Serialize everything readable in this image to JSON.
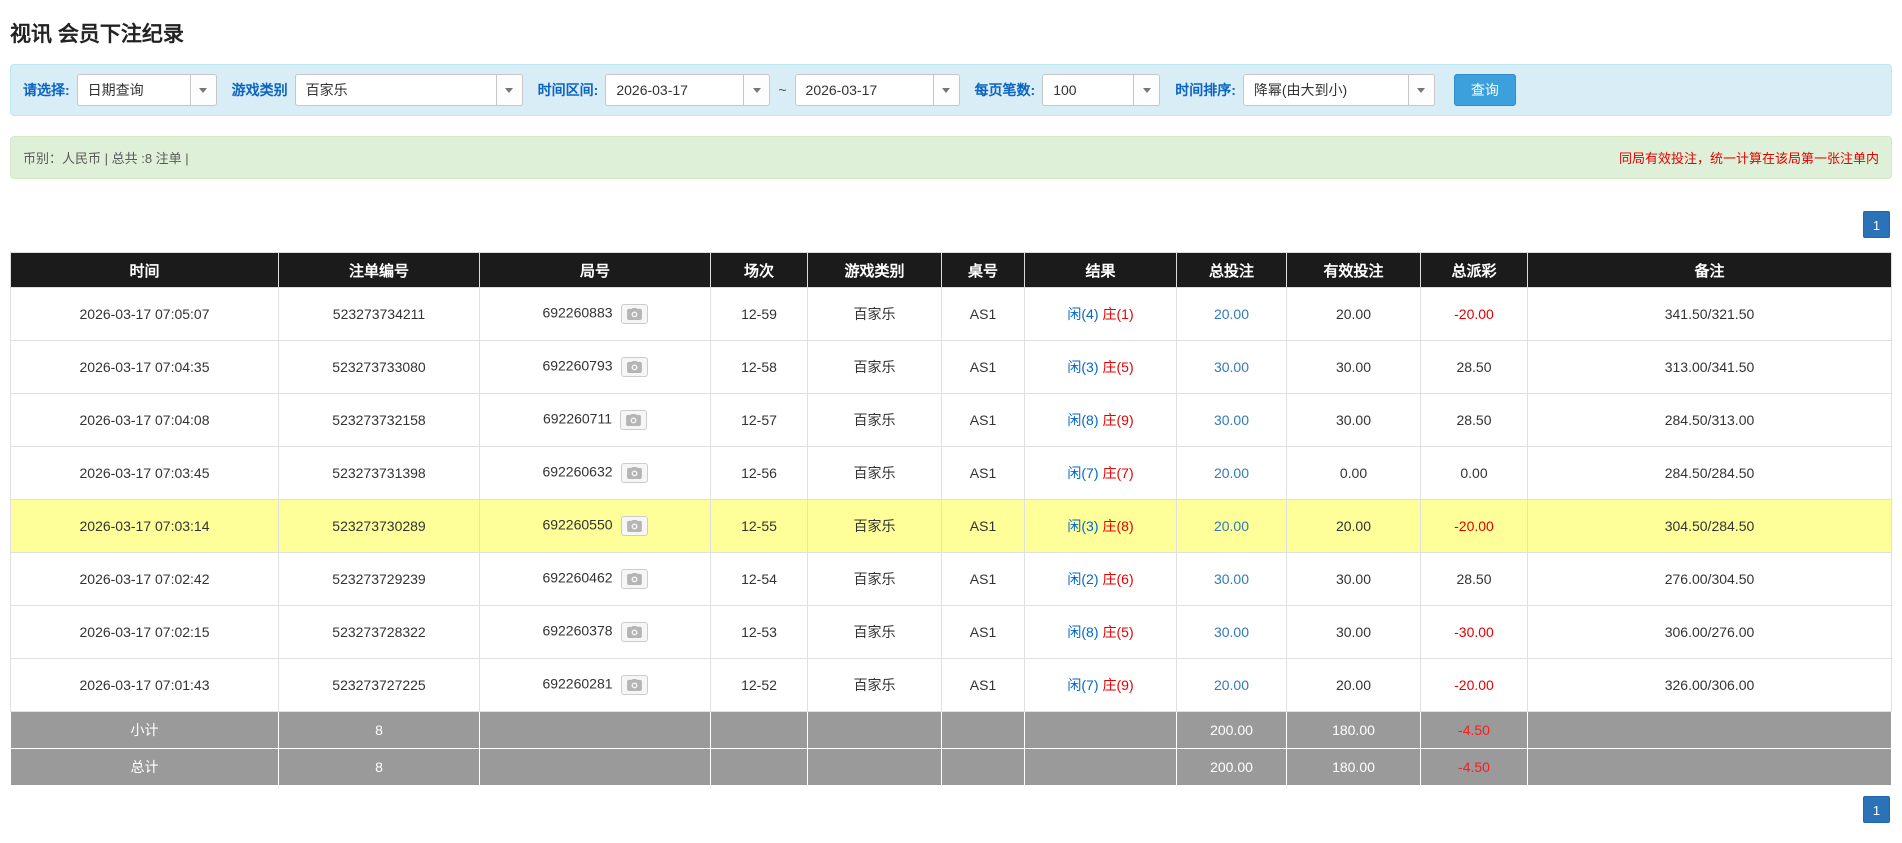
{
  "page": {
    "title": "视讯 会员下注纪录"
  },
  "filter": {
    "select_label": "请选择:",
    "query_type": "日期查询",
    "game_type_label": "游戏类别",
    "game_type": "百家乐",
    "time_range_label": "时间区间:",
    "date_from": "2026-03-17",
    "range_separator": "~",
    "date_to": "2026-03-17",
    "page_size_label": "每页笔数:",
    "page_size": "100",
    "sort_label": "时间排序:",
    "sort_value": "降幂(由大到小)",
    "search_button": "查询"
  },
  "info_bar": {
    "summary": "币别：人民币 | 总共 :8 注单 |",
    "notice": "同局有效投注，统一计算在该局第一张注单内"
  },
  "pagination": {
    "page": "1"
  },
  "colors": {
    "accent_blue": "#0a64c2",
    "link_blue": "#337ab7",
    "negative_red": "#e60000",
    "player_blue": "#0066cc",
    "banker_red": "#e60000",
    "highlight_yellow": "#ffff99",
    "header_bg": "#1b1b1b",
    "summary_bg": "#9a9a9a"
  },
  "table": {
    "headers": [
      "时间",
      "注单编号",
      "局号",
      "场次",
      "游戏类别",
      "桌号",
      "结果",
      "总投注",
      "有效投注",
      "总派彩",
      "备注"
    ],
    "rows": [
      {
        "time": "2026-03-17 07:05:07",
        "bet_id": "523273734211",
        "round_no": "692260883",
        "session": "12-59",
        "game_type": "百家乐",
        "table_no": "AS1",
        "result_player": "闲(4)",
        "result_banker": "庄(1)",
        "total_bet": "20.00",
        "valid_bet": "20.00",
        "payout": "-20.00",
        "remark": "341.50/321.50",
        "highlight": false
      },
      {
        "time": "2026-03-17 07:04:35",
        "bet_id": "523273733080",
        "round_no": "692260793",
        "session": "12-58",
        "game_type": "百家乐",
        "table_no": "AS1",
        "result_player": "闲(3)",
        "result_banker": "庄(5)",
        "total_bet": "30.00",
        "valid_bet": "30.00",
        "payout": "28.50",
        "remark": "313.00/341.50",
        "highlight": false
      },
      {
        "time": "2026-03-17 07:04:08",
        "bet_id": "523273732158",
        "round_no": "692260711",
        "session": "12-57",
        "game_type": "百家乐",
        "table_no": "AS1",
        "result_player": "闲(8)",
        "result_banker": "庄(9)",
        "total_bet": "30.00",
        "valid_bet": "30.00",
        "payout": "28.50",
        "remark": "284.50/313.00",
        "highlight": false
      },
      {
        "time": "2026-03-17 07:03:45",
        "bet_id": "523273731398",
        "round_no": "692260632",
        "session": "12-56",
        "game_type": "百家乐",
        "table_no": "AS1",
        "result_player": "闲(7)",
        "result_banker": "庄(7)",
        "total_bet": "20.00",
        "valid_bet": "0.00",
        "payout": "0.00",
        "remark": "284.50/284.50",
        "highlight": false
      },
      {
        "time": "2026-03-17 07:03:14",
        "bet_id": "523273730289",
        "round_no": "692260550",
        "session": "12-55",
        "game_type": "百家乐",
        "table_no": "AS1",
        "result_player": "闲(3)",
        "result_banker": "庄(8)",
        "total_bet": "20.00",
        "valid_bet": "20.00",
        "payout": "-20.00",
        "remark": "304.50/284.50",
        "highlight": true
      },
      {
        "time": "2026-03-17 07:02:42",
        "bet_id": "523273729239",
        "round_no": "692260462",
        "session": "12-54",
        "game_type": "百家乐",
        "table_no": "AS1",
        "result_player": "闲(2)",
        "result_banker": "庄(6)",
        "total_bet": "30.00",
        "valid_bet": "30.00",
        "payout": "28.50",
        "remark": "276.00/304.50",
        "highlight": false
      },
      {
        "time": "2026-03-17 07:02:15",
        "bet_id": "523273728322",
        "round_no": "692260378",
        "session": "12-53",
        "game_type": "百家乐",
        "table_no": "AS1",
        "result_player": "闲(8)",
        "result_banker": "庄(5)",
        "total_bet": "30.00",
        "valid_bet": "30.00",
        "payout": "-30.00",
        "remark": "306.00/276.00",
        "highlight": false
      },
      {
        "time": "2026-03-17 07:01:43",
        "bet_id": "523273727225",
        "round_no": "692260281",
        "session": "12-52",
        "game_type": "百家乐",
        "table_no": "AS1",
        "result_player": "闲(7)",
        "result_banker": "庄(9)",
        "total_bet": "20.00",
        "valid_bet": "20.00",
        "payout": "-20.00",
        "remark": "326.00/306.00",
        "highlight": false
      }
    ],
    "subtotal": {
      "label": "小计",
      "count": "8",
      "total_bet": "200.00",
      "valid_bet": "180.00",
      "payout": "-4.50"
    },
    "total": {
      "label": "总计",
      "count": "8",
      "total_bet": "200.00",
      "valid_bet": "180.00",
      "payout": "-4.50"
    }
  }
}
